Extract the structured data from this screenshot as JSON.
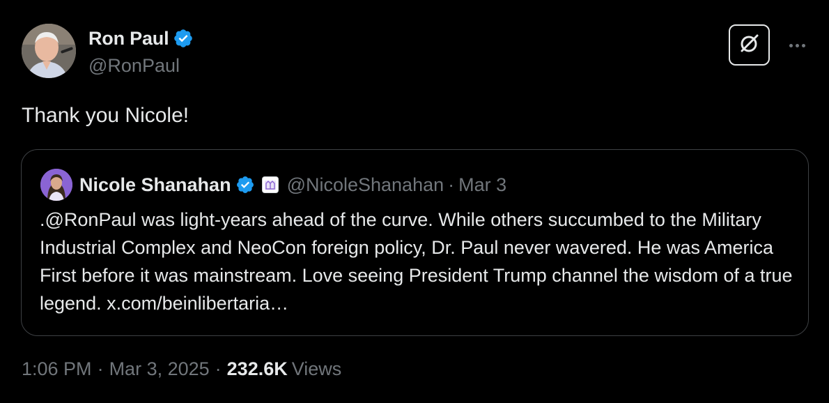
{
  "author": {
    "name": "Ron Paul",
    "handle": "@RonPaul",
    "verified_icon": "verified-badge-icon"
  },
  "tweet": {
    "text": "Thank you Nicole!"
  },
  "quote": {
    "name": "Nicole Shanahan",
    "handle": "@NicoleShanahan",
    "separator": "·",
    "date": "Mar 3",
    "text": ".@RonPaul was light-years ahead of the curve. While others succumbed to the Military Industrial Complex and NeoCon foreign policy, Dr. Paul never wavered. He was America First before it was mainstream. Love seeing President Trump channel the wisdom of a true legend. x.com/beinlibertaria…"
  },
  "meta": {
    "time": "1:06 PM",
    "dot1": "·",
    "date": "Mar 3, 2025",
    "dot2": "·",
    "views_count": "232.6K",
    "views_label": "Views"
  },
  "colors": {
    "background": "#000000",
    "text_primary": "#e7e9ea",
    "text_secondary": "#71767b",
    "verified_blue": "#1d9bf0",
    "border": "#3e4144"
  },
  "icons": {
    "grok": "grok-icon",
    "more": "more-icon",
    "affiliate": "affiliate-badge-icon"
  }
}
